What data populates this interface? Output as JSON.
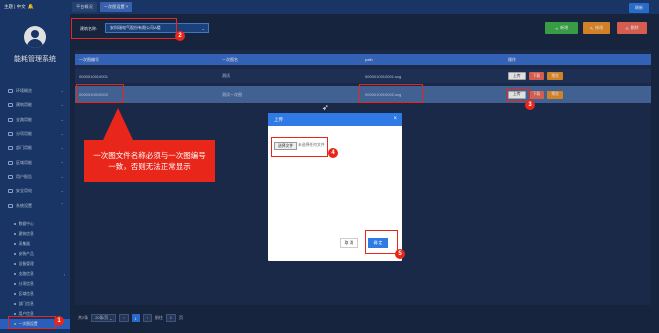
{
  "app": {
    "topbar_left": "主题 | 中文",
    "system_title": "能耗管理系统"
  },
  "sidebar": {
    "menu": [
      {
        "label": "环境概览"
      },
      {
        "label": "建筑用能"
      },
      {
        "label": "支路用能"
      },
      {
        "label": "分项用能"
      },
      {
        "label": "部门用能"
      },
      {
        "label": "区域用能"
      },
      {
        "label": "用户报告"
      },
      {
        "label": "安全用电"
      },
      {
        "label": "系统设置"
      }
    ],
    "submenu": [
      {
        "label": "数据中心"
      },
      {
        "label": "建筑信息"
      },
      {
        "label": "采集器"
      },
      {
        "label": "安装产品"
      },
      {
        "label": "设备管理"
      },
      {
        "label": "支路信息"
      },
      {
        "label": "分项信息"
      },
      {
        "label": "区域信息"
      },
      {
        "label": "部门信息"
      },
      {
        "label": "用户信息"
      },
      {
        "label": "一次图设置"
      }
    ]
  },
  "tabs": [
    {
      "label": "平台概况"
    },
    {
      "label": "一次图设置 ×"
    }
  ],
  "toolbar": {
    "refresh": "刷新",
    "building_label": "建筑名称:",
    "building_value": "安科瑞电气股份有限公司A楼",
    "add": "新增",
    "edit": "修改",
    "delete": "删除"
  },
  "table": {
    "headers": [
      "一次图编号",
      "一次图名",
      "path",
      "操作"
    ],
    "rows": [
      {
        "code": "0000010010001",
        "name": "测试",
        "path": "0000010010001.svg"
      },
      {
        "code": "0000010010002",
        "name": "测试一次图",
        "path": "0000010010002.svg"
      }
    ],
    "op_upload": "上传",
    "op_download": "下载",
    "op_preview": "预览"
  },
  "pager": {
    "total": "共2条",
    "page_size": "20条/页",
    "prev": "‹",
    "page": "1",
    "next": "›",
    "goto_label": "前往",
    "goto_value": "1",
    "goto_suffix": "页"
  },
  "dialog": {
    "title": "上传",
    "choose_file": "选择文件",
    "file_status": "未选择任何文件",
    "cancel": "取 消",
    "ok": "确 定"
  },
  "annotations": {
    "callout": "一次图文件名称必须与一次图编号一致，否则无法正常显示",
    "badges": [
      "1",
      "2",
      "3",
      "4",
      "5"
    ]
  },
  "colors": {
    "accent": "#2f7ae5",
    "annotation_red": "#e8261a",
    "sidebar_bg": "#1c3d73",
    "add_green": "#3fb24d",
    "edit_orange": "#f0932c",
    "delete_red": "#f26a5a"
  }
}
